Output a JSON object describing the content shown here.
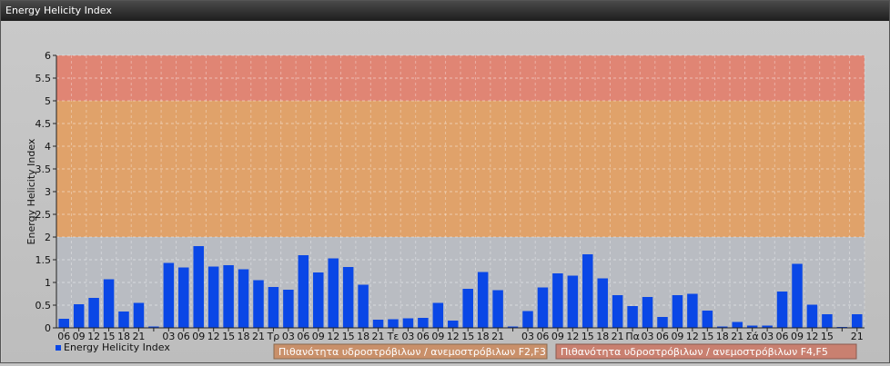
{
  "window": {
    "title": "Energy Helicity Index"
  },
  "colors": {
    "band_high": "#e08574",
    "band_mid": "#e0a26a",
    "band_low": "#b9bcc2",
    "bar": "#0a47e6",
    "legend_box_1": "#c9906a",
    "legend_box_2": "#c98070"
  },
  "chart_data": {
    "type": "bar",
    "ylabel": "Energy Helicity Index",
    "ylim": [
      0,
      6
    ],
    "yticks": [
      "0",
      "0.5",
      "1",
      "1.5",
      "2",
      "2.5",
      "3",
      "3.5",
      "4",
      "4.5",
      "5",
      "5.5",
      "6"
    ],
    "grid": true,
    "bands": [
      {
        "from": 0,
        "to": 2,
        "color": "#b9bcc2"
      },
      {
        "from": 2,
        "to": 5,
        "color": "#e0a26a"
      },
      {
        "from": 5,
        "to": 6,
        "color": "#e08574"
      }
    ],
    "categories": [
      "06",
      "09",
      "12",
      "15",
      "18",
      "21",
      "",
      "03",
      "06",
      "09",
      "12",
      "15",
      "18",
      "21",
      "Τρ",
      "03",
      "06",
      "09",
      "12",
      "15",
      "18",
      "21",
      "Τε",
      "03",
      "06",
      "09",
      "12",
      "15",
      "18",
      "21",
      "",
      "03",
      "06",
      "09",
      "12",
      "15",
      "18",
      "21",
      "Πα",
      "03",
      "06",
      "09",
      "12",
      "15",
      "18",
      "21",
      "Σά",
      "03",
      "06",
      "09",
      "12",
      "15",
      "",
      "21"
    ],
    "series": [
      {
        "name": "Energy Helicity Index",
        "values": [
          0.2,
          0.52,
          0.66,
          1.07,
          0.36,
          0.55,
          0.03,
          1.43,
          1.33,
          1.8,
          1.35,
          1.38,
          1.29,
          1.05,
          0.9,
          0.84,
          1.6,
          1.22,
          1.53,
          1.34,
          0.95,
          0.18,
          0.19,
          0.21,
          0.22,
          0.55,
          0.16,
          0.86,
          1.23,
          0.83,
          0.03,
          0.37,
          0.89,
          1.2,
          1.15,
          1.62,
          1.09,
          0.72,
          0.48,
          0.68,
          0.24,
          0.72,
          0.75,
          0.38,
          0.03,
          0.13,
          0.05,
          0.05,
          0.8,
          1.41,
          0.51,
          0.3,
          0.02,
          0.3
        ]
      }
    ],
    "legend": {
      "series_label": "Energy Helicity Index",
      "band_label_1": "Πιθανότητα υδροστρόβιλων / ανεμοστρόβιλων F2,F3",
      "band_label_2": "Πιθανότητα υδροστρόβιλων / ανεμοστρόβιλων F4,F5"
    }
  }
}
